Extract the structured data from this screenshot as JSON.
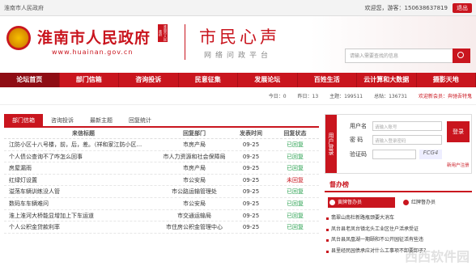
{
  "topbar": {
    "left": "淮南市人民政府",
    "welcome": "欢迎您，游客：15063863781​9",
    "logout": "退出"
  },
  "header": {
    "gov_name": "淮南市人民政府",
    "seal": "淮南市人民政府",
    "url": "www.huainan.gov.cn",
    "section": "市民心声",
    "sub": "网络问政平台",
    "search_placeholder": "请输入需要查找的信息"
  },
  "nav": [
    "论坛首页",
    "部门信箱",
    "咨询投诉",
    "民意征集",
    "发展论坛",
    "百姓生活",
    "云计算和大数据",
    "摄影天地"
  ],
  "stats": {
    "today": "今日：0",
    "yesterday": "昨日：13",
    "posts": "主题：199511",
    "total": "总贴：136731",
    "welcome": "欢迎新会员：奔驰吾特鬼"
  },
  "tabs": [
    "部门信箱",
    "咨询投诉",
    "最新主题",
    "回复统计"
  ],
  "table": {
    "headers": [
      "来信标题",
      "回复部门",
      "发表时间",
      "回复状态"
    ],
    "rows": [
      {
        "title": "江防小区十八号楼，前，后，差。（祥和家江防小区...",
        "dept": "市房产局",
        "date": "09-25",
        "status": "已回复",
        "ok": true
      },
      {
        "title": "个人债公查询不了咋怎么回事",
        "dept": "市人力资源和社会保障局",
        "date": "09-25",
        "status": "已回复",
        "ok": true
      },
      {
        "title": "房屋漏雨",
        "dept": "市房产局",
        "date": "09-25",
        "status": "已回复",
        "ok": true
      },
      {
        "title": "红绿灯设置",
        "dept": "市公安局",
        "date": "09-25",
        "status": "未回复",
        "ok": false
      },
      {
        "title": "溢荡车辆训练没人管",
        "dept": "市公路运输管理处",
        "date": "09-25",
        "status": "已回复",
        "ok": true
      },
      {
        "title": "数码车车辆难问",
        "dept": "市公安局",
        "date": "09-25",
        "status": "已回复",
        "ok": true
      },
      {
        "title": "淮上淮河大桥能显增加上下车运道",
        "dept": "市交通运输局",
        "date": "09-25",
        "status": "已回复",
        "ok": true
      },
      {
        "title": "个人公积金贷款利率",
        "dept": "市住房公积金管理中心",
        "date": "09-25",
        "status": "已回复",
        "ok": true
      }
    ]
  },
  "login": {
    "side": "用户登录",
    "user_label": "用户名",
    "user_ph": "请输入账号",
    "pwd_label": "密  码",
    "pwd_ph": "请输入登录密码",
    "code_label": "验证码",
    "code": "FCG4",
    "button": "登录",
    "register": "新用户注册"
  },
  "review": {
    "title": "督办榜",
    "tab1": "黄牌督办员",
    "tab2": "红牌督办员"
  },
  "news": [
    "翡翠山南杜新路瓶颈要大消车",
    "凤台县老凤台镇北头工业区住户活承受证",
    "凤台县凤凰湖一期颐和不公开园征活有些违",
    "县里经民园债承应对什么工事项不卸要卸子？"
  ],
  "watermark": "西西软件园"
}
